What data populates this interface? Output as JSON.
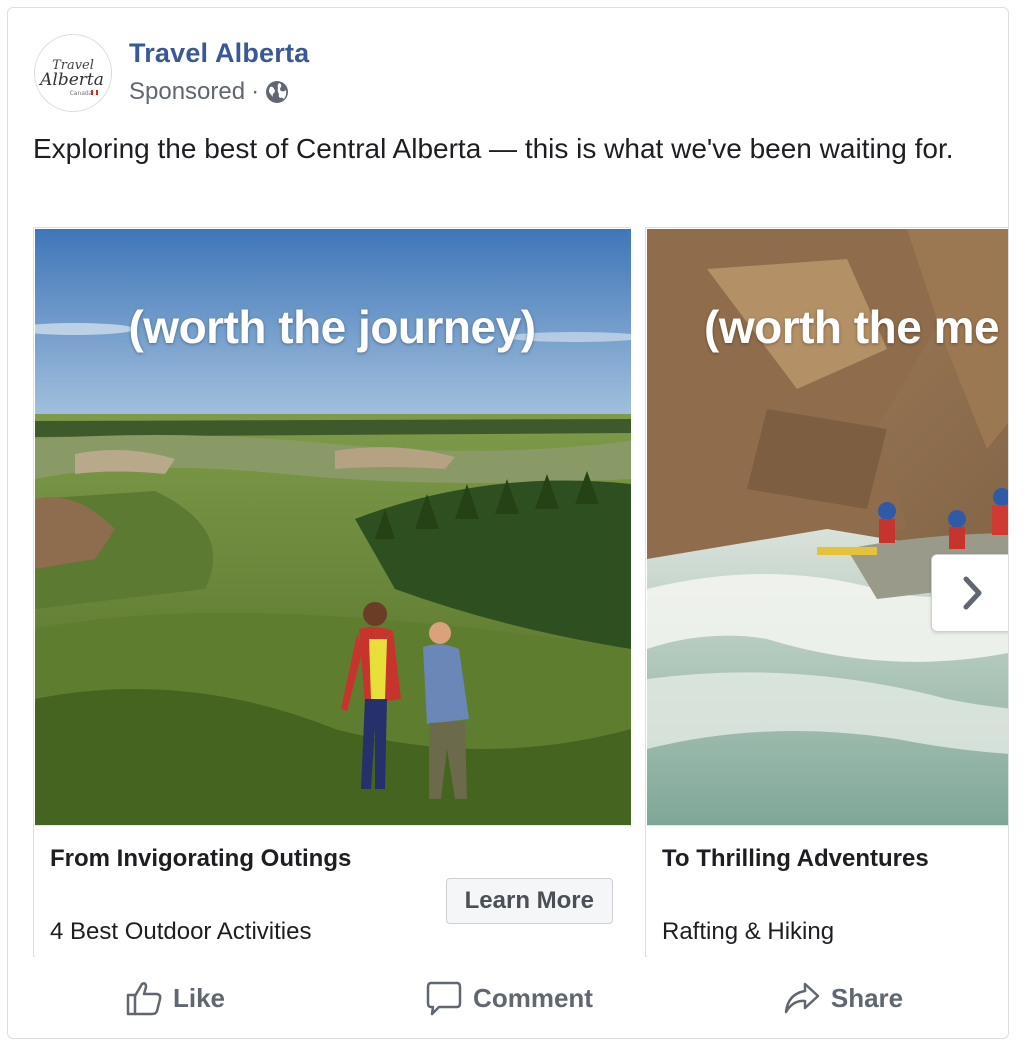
{
  "post": {
    "page_name": "Travel Alberta",
    "sponsored_label": "Sponsored",
    "separator": "·",
    "audience_icon": "globe-icon",
    "caption": "Exploring the best of Central Alberta — this is what we've been waiting for.",
    "logo": {
      "line1": "Travel",
      "line2": "Alberta",
      "line3": "Canada"
    }
  },
  "carousel": {
    "cards": [
      {
        "tagline": "(worth the journey)",
        "headline": "From Invigorating Outings",
        "description": "4 Best Outdoor Activities",
        "cta_label": "Learn More"
      },
      {
        "tagline": "(worth the me",
        "headline": "To Thrilling Adventures",
        "description": "Rafting & Hiking"
      }
    ],
    "next_icon": "chevron-right-icon"
  },
  "actions": {
    "like_label": "Like",
    "comment_label": "Comment",
    "share_label": "Share"
  },
  "colors": {
    "page_name": "#385898",
    "meta_text": "#606770",
    "action_text": "#606770",
    "border": "#dddfe2"
  }
}
